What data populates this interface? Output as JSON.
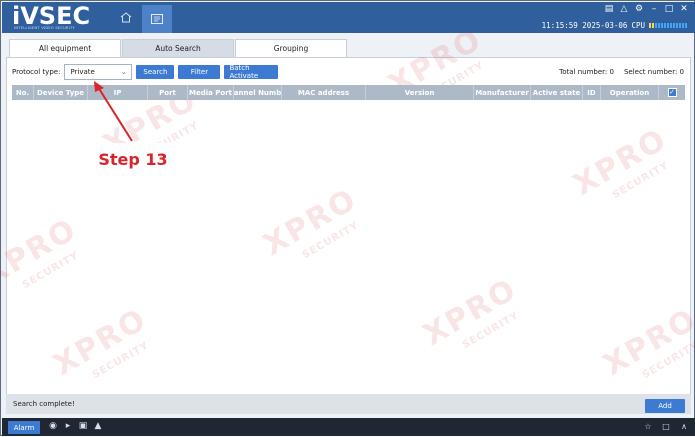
{
  "app": {
    "logo": "iVSEC",
    "logo_tagline": "INTELLIGENT VIDEO SECURITY",
    "clock": "11:15:59 2025-03-06",
    "cpu_label": "CPU"
  },
  "tabs": [
    {
      "label": "All equipment",
      "active": true
    },
    {
      "label": "Auto Search",
      "active": false
    },
    {
      "label": "Grouping",
      "active": false
    }
  ],
  "toolbar": {
    "protocol_label": "Protocol type:",
    "protocol_value": "Private",
    "search_label": "Search",
    "filter_label": "Filter",
    "batch_label": "Batch Activate",
    "total_text": "Total number:  0",
    "select_text": "Select number:  0"
  },
  "table": {
    "columns": [
      "No.",
      "Device Type",
      "IP",
      "Port",
      "Media Port",
      "annel Numb",
      "MAC address",
      "Version",
      "Manufacturer",
      "Active state",
      "ID",
      "Operation"
    ],
    "rows": []
  },
  "annotation": {
    "label": "Step 13"
  },
  "watermark": {
    "big": "XPRO",
    "small": "SECURITY"
  },
  "status": {
    "text": "Search complete!"
  },
  "actions": {
    "add_label": "Add"
  },
  "bottom": {
    "alarm_label": "Alarm"
  },
  "colors": {
    "brand": "#2f5f9c",
    "accent": "#3d7ad1",
    "annotation": "#d8242a"
  }
}
